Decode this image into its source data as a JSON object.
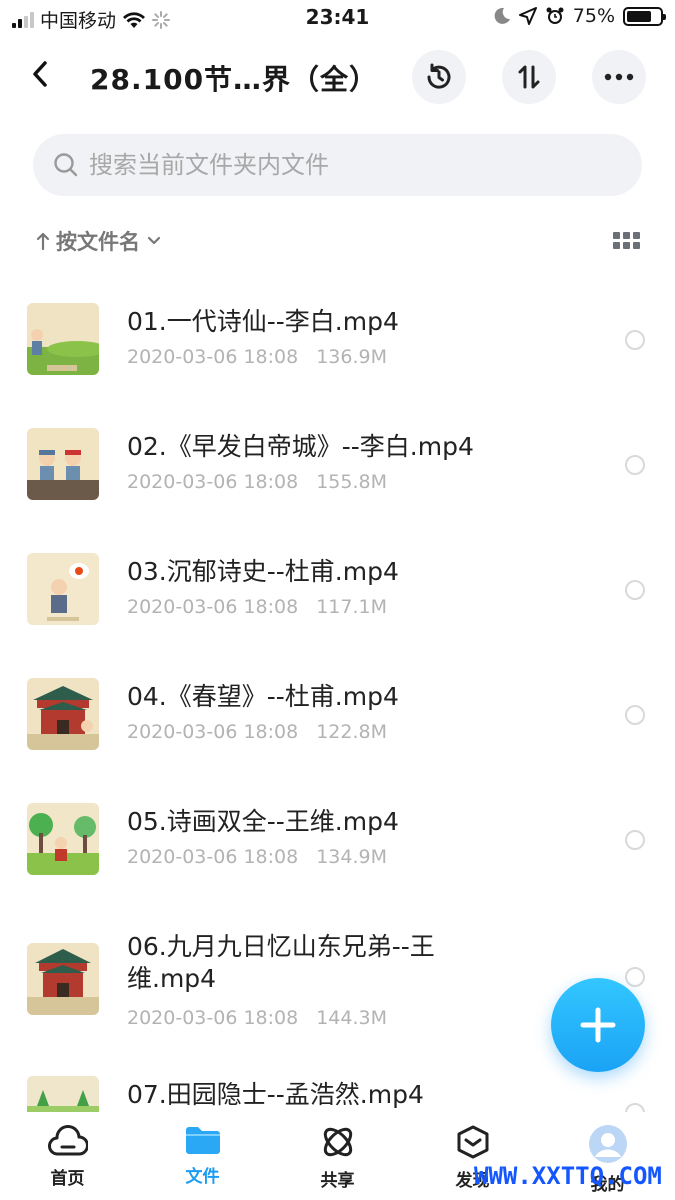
{
  "status_bar": {
    "carrier": "中国移动",
    "time": "23:41",
    "battery": "75%",
    "battery_level": 0.75
  },
  "header": {
    "title": "28.100节…界（全）",
    "back_icon": "chevron-left-icon",
    "history_icon": "history-icon",
    "sort_icon": "transfer-icon",
    "more_icon": "more-icon"
  },
  "search": {
    "placeholder": "搜索当前文件夹内文件"
  },
  "sort": {
    "label": "按文件名"
  },
  "files": [
    {
      "name": "01.一代诗仙--李白.mp4",
      "date": "2020-03-06 18:08",
      "size": "136.9M"
    },
    {
      "name": "02.《早发白帝城》--李白.mp4",
      "date": "2020-03-06 18:08",
      "size": "155.8M"
    },
    {
      "name": "03.沉郁诗史--杜甫.mp4",
      "date": "2020-03-06 18:08",
      "size": "117.1M"
    },
    {
      "name": "04.《春望》--杜甫.mp4",
      "date": "2020-03-06 18:08",
      "size": "122.8M"
    },
    {
      "name": "05.诗画双全--王维.mp4",
      "date": "2020-03-06 18:08",
      "size": "134.9M"
    },
    {
      "name": "06.九月九日忆山东兄弟--王维.mp4",
      "date": "2020-03-06 18:08",
      "size": "144.3M"
    },
    {
      "name": "07.田园隐士--孟浩然.mp4",
      "date": "",
      "size": ""
    }
  ],
  "tabs": [
    {
      "label": "首页",
      "icon": "cloud-icon"
    },
    {
      "label": "文件",
      "icon": "folder-icon"
    },
    {
      "label": "共享",
      "icon": "share-icon"
    },
    {
      "label": "发现",
      "icon": "discover-icon"
    },
    {
      "label": "我的",
      "icon": "avatar-icon"
    }
  ],
  "watermark": "WWW.XXTTQ.COM",
  "colors": {
    "accent": "#1b9cf2",
    "fab": "#1aa3f5"
  }
}
